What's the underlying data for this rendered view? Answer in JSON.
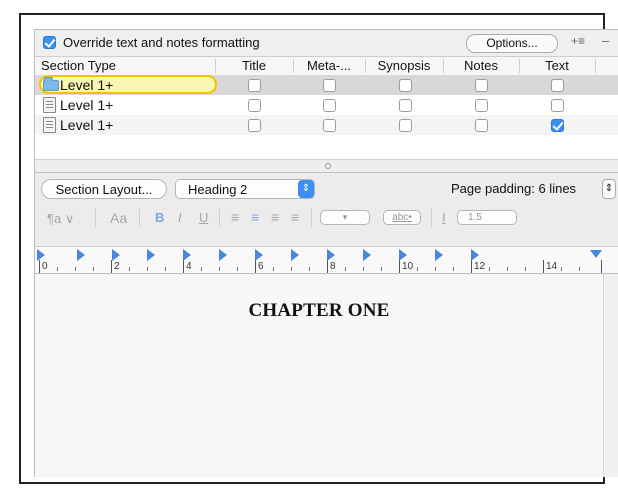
{
  "options": {
    "override_label": "Override text and notes formatting",
    "override_checked": true,
    "options_button": "Options...",
    "plus_icon": "+≡",
    "minus_icon": "–"
  },
  "table": {
    "headers": [
      "Section Type",
      "Title",
      "Meta-...",
      "Synopsis",
      "Notes",
      "Text"
    ],
    "rows": [
      {
        "name": "Level  1+",
        "icon": "folder-icon",
        "checks": [
          false,
          false,
          false,
          false,
          false
        ]
      },
      {
        "name": "Level  1+",
        "icon": "document-icon",
        "checks": [
          false,
          false,
          false,
          false,
          false
        ]
      },
      {
        "name": "Level  1+",
        "icon": "document-icon",
        "checks": [
          false,
          false,
          false,
          false,
          true
        ]
      }
    ]
  },
  "controls": {
    "section_layout": "Section Layout...",
    "style_select": "Heading 2",
    "page_padding": "Page padding: 6 lines",
    "paragraph_style": "¶a ∨",
    "font_button": "Aa",
    "bold": "B",
    "italic": "I",
    "underline": "U",
    "highlight_select": "abc•",
    "line_spacing": "1.5"
  },
  "ruler": {
    "labels": [
      "0",
      "2",
      "4",
      "6",
      "8",
      "10",
      "12",
      "14"
    ]
  },
  "editor": {
    "text": "CHAPTER ONE"
  },
  "colors": {
    "accent": "#3b8ff0",
    "selection_yellow": "#f2c400",
    "folder_blue": "#7fb8e8"
  }
}
